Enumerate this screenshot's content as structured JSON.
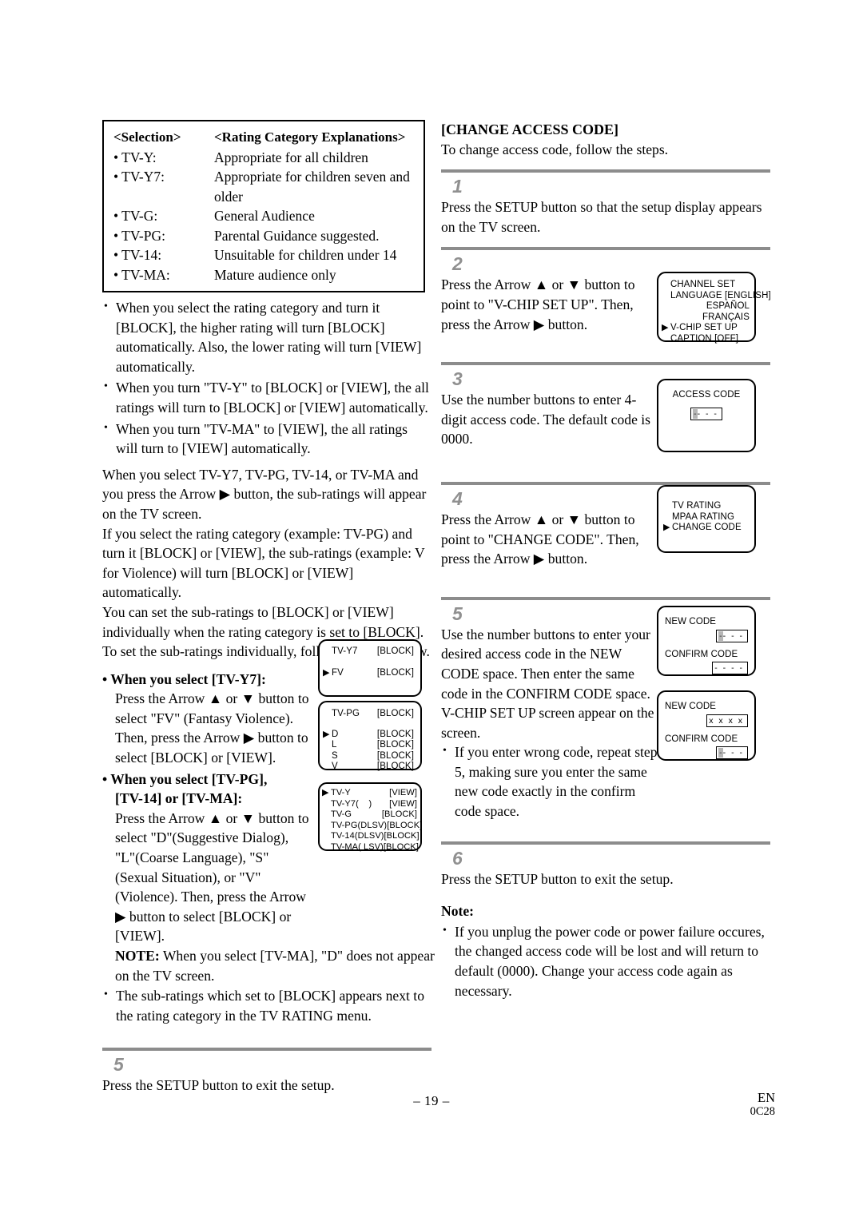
{
  "rating_table": {
    "header": {
      "selection": "<Selection>",
      "explanations": "<Rating Category Explanations>"
    },
    "rows": [
      {
        "selection": "• TV-Y:",
        "explanation": "Appropriate for all children",
        "cont": ""
      },
      {
        "selection": "• TV-Y7:",
        "explanation": "Appropriate for children seven and",
        "cont": "older"
      },
      {
        "selection": "• TV-G:",
        "explanation": "General Audience",
        "cont": ""
      },
      {
        "selection": "• TV-PG:",
        "explanation": "Parental Guidance suggested.",
        "cont": ""
      },
      {
        "selection": "• TV-14:",
        "explanation": "Unsuitable for children under 14",
        "cont": ""
      },
      {
        "selection": "• TV-MA:",
        "explanation": "Mature audience only",
        "cont": ""
      }
    ]
  },
  "left_column": {
    "notes_bullets": [
      "When you select the rating category and turn it [BLOCK], the higher rating will turn [BLOCK] automatically. Also, the lower rating will turn [VIEW] automatically.",
      "When you turn \"TV-Y\" to [BLOCK] or [VIEW], the all ratings will turn to [BLOCK] or [VIEW] automatically.",
      "When you turn \"TV-MA\" to [VIEW], the all ratings will turn to [VIEW] automatically."
    ],
    "paragraph1": "When you select TV-Y7, TV-PG, TV-14, or TV-MA and you press the Arrow ▶ button, the sub-ratings will appear on the TV screen.",
    "paragraph2": "If you select the rating category (example: TV-PG) and turn it [BLOCK] or [VIEW], the sub-ratings (example: V for Violence) will turn [BLOCK] or [VIEW] automatically.",
    "paragraph3": "You can set the sub-ratings to [BLOCK] or [VIEW] individually when the rating category is set to [BLOCK]. To set the sub-ratings individually, follow the steps below.",
    "tvy7_heading": "• When you select [TV-Y7]:",
    "tvy7_body": "Press the Arrow ▲ or ▼ button to select \"FV\" (Fantasy Violence). Then, press the Arrow ▶ button to select [BLOCK] or [VIEW].",
    "tvpg_heading_line1": "• When you select [TV-PG],",
    "tvpg_heading_line2": "[TV-14] or [TV-MA]:",
    "tvpg_body": "Press the Arrow ▲ or ▼ button to select \"D\"(Suggestive Dialog), \"L\"(Coarse Language), \"S\"(Sexual Situation), or \"V\"(Violence). Then, press the Arrow ▶ button to select [BLOCK] or [VIEW].",
    "note_label": "NOTE:",
    "note_text": " When you select [TV-MA], \"D\" does not appear on the TV screen.",
    "final_bullet": "The sub-ratings which set to [BLOCK] appears next to the rating category in the TV RATING menu.",
    "step5_num": "5",
    "step5_text": "Press the SETUP button to exit the setup."
  },
  "screens": {
    "tvy7": {
      "rows": [
        {
          "arrow": "",
          "label": "TV-Y7",
          "value": "[BLOCK]"
        },
        {
          "arrow": "▶",
          "label": "FV",
          "value": "[BLOCK]"
        }
      ]
    },
    "tvpg": {
      "rows": [
        {
          "arrow": "",
          "label": "TV-PG",
          "value": "[BLOCK]"
        },
        {
          "arrow": "▶",
          "label": "D",
          "value": "[BLOCK]"
        },
        {
          "arrow": "",
          "label": "L",
          "value": "[BLOCK]"
        },
        {
          "arrow": "",
          "label": "S",
          "value": "[BLOCK]"
        },
        {
          "arrow": "",
          "label": "V",
          "value": "[BLOCK]"
        }
      ]
    },
    "tvrating": {
      "rows": [
        {
          "arrow": "▶",
          "label": "TV-Y",
          "subs": "",
          "value": "[VIEW]"
        },
        {
          "arrow": "",
          "label": "TV-Y7",
          "subs": "(    )",
          "value": "[VIEW]"
        },
        {
          "arrow": "",
          "label": "TV-G",
          "subs": "",
          "value": "[BLOCK]"
        },
        {
          "arrow": "",
          "label": "TV-PG",
          "subs": "(DLSV)",
          "value": "[BLOCK]"
        },
        {
          "arrow": "",
          "label": "TV-14",
          "subs": "(DLSV)",
          "value": "[BLOCK]"
        },
        {
          "arrow": "",
          "label": "TV-MA",
          "subs": "( LSV)",
          "value": "[BLOCK]"
        }
      ]
    },
    "setup_menu": {
      "lines": [
        {
          "arrow": "",
          "text": "CHANNEL SET",
          "align": "left"
        },
        {
          "arrow": "",
          "text": "LANGUAGE [ENGLISH]",
          "align": "left"
        },
        {
          "arrow": "",
          "text": "ESPAÑOL",
          "align": "right"
        },
        {
          "arrow": "",
          "text": "FRANÇAIS",
          "align": "right"
        },
        {
          "arrow": "▶",
          "text": "V-CHIP SET UP",
          "align": "left"
        },
        {
          "arrow": "",
          "text": "CAPTION [OFF]",
          "align": "left"
        }
      ]
    },
    "access_code": {
      "title": "ACCESS CODE",
      "field_cursor": "-",
      "field_rest": "- - -"
    },
    "vchip_menu": {
      "lines": [
        {
          "arrow": "",
          "text": "TV RATING"
        },
        {
          "arrow": "",
          "text": "MPAA RATING"
        },
        {
          "arrow": "▶",
          "text": "CHANGE CODE"
        }
      ]
    },
    "new_code_a": {
      "new_label": "NEW CODE",
      "new_cursor": "-",
      "new_rest": "- - -",
      "confirm_label": "CONFIRM CODE",
      "confirm_value": "- - - -"
    },
    "new_code_b": {
      "new_label": "NEW CODE",
      "new_value": "x x x x",
      "confirm_label": "CONFIRM CODE",
      "confirm_cursor": "-",
      "confirm_rest": "- - -"
    }
  },
  "right_column": {
    "title": "[CHANGE ACCESS CODE]",
    "intro": "To change access code, follow the steps.",
    "steps": [
      {
        "num": "1",
        "text": "Press the SETUP button so that the setup display appears on the TV screen."
      },
      {
        "num": "2",
        "text": "Press the Arrow ▲ or ▼ button to point to \"V-CHIP SET UP\". Then, press the Arrow ▶ button."
      },
      {
        "num": "3",
        "text": "Use the number buttons to enter 4-digit access code. The default code is 0000."
      },
      {
        "num": "4",
        "text": "Press the Arrow ▲ or ▼ button to point to \"CHANGE CODE\". Then, press the Arrow ▶ button."
      },
      {
        "num": "5",
        "text": "Use the number buttons to enter your desired access code in the NEW CODE space. Then enter the same code in the CONFIRM CODE space. V-CHIP SET UP screen appear on the screen."
      },
      {
        "num": "6",
        "text": "Press the SETUP button to exit the setup."
      }
    ],
    "step5_bullet": "If you enter wrong code, repeat step 5, making sure you enter the same new code exactly in the confirm code space.",
    "note_label": "Note:",
    "note_bullet": "If you unplug the power code or power failure occures, the changed access code will be lost and will return to default (0000). Change your access code again as necessary."
  },
  "footer": {
    "page_number": "– 19 –",
    "lang": "EN",
    "code": "0C28"
  }
}
